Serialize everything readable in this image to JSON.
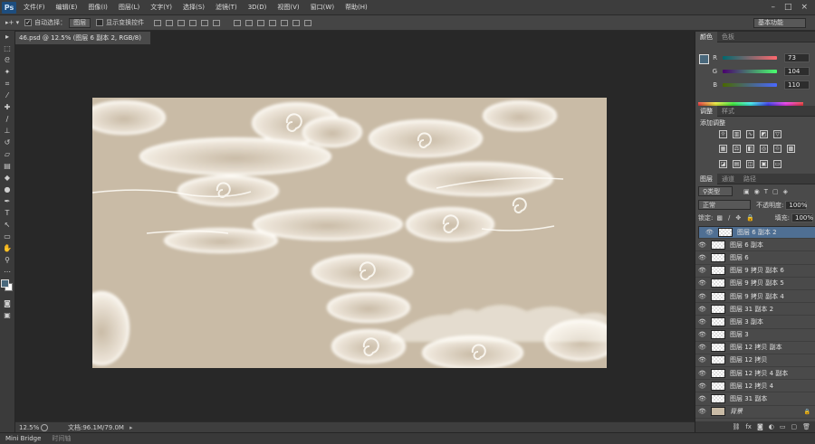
{
  "menubar": {
    "logo": "Ps",
    "items": [
      "文件(F)",
      "编辑(E)",
      "图像(I)",
      "图层(L)",
      "文字(Y)",
      "选择(S)",
      "滤镜(T)",
      "3D(D)",
      "视图(V)",
      "窗口(W)",
      "帮助(H)"
    ],
    "window_controls": [
      "minimize-icon",
      "maximize-icon",
      "close-icon"
    ]
  },
  "options": {
    "auto_select_label": "自动选择：",
    "auto_select_checked": true,
    "auto_select_value": "图层",
    "show_transform_label": "显示变换控件",
    "workspace": "基本功能"
  },
  "document": {
    "tab_title": "46.psd @ 12.5% (图层 6 副本 2, RGB/8)",
    "zoom": "12.5%",
    "doc_info": "文档:96.1M/79.0M",
    "canvas_color": "#c9bba6"
  },
  "bottom_tabs": [
    "Mini Bridge",
    "时间轴"
  ],
  "color_panel": {
    "tabs": [
      "颜色",
      "色板"
    ],
    "fg_color": "#49687c",
    "channels": [
      {
        "label": "R",
        "value": "73"
      },
      {
        "label": "G",
        "value": "104"
      },
      {
        "label": "B",
        "value": "110"
      }
    ]
  },
  "adjust_panel": {
    "tabs": [
      "调整",
      "样式"
    ],
    "title": "添加调整"
  },
  "layers_panel": {
    "tabs": [
      "图层",
      "通道",
      "路径"
    ],
    "filter": "类型",
    "blend_mode": "正常",
    "opacity_label": "不透明度:",
    "opacity": "100%",
    "lock_label": "锁定:",
    "fill_label": "填充:",
    "fill": "100%",
    "layers": [
      {
        "name": "图层 6 副本 2",
        "selected": true
      },
      {
        "name": "图层 6 副本"
      },
      {
        "name": "图层 6"
      },
      {
        "name": "图层 9 拷贝 副本 6"
      },
      {
        "name": "图层 9 拷贝 副本 5"
      },
      {
        "name": "图层 9 拷贝 副本 4"
      },
      {
        "name": "图层 31 副本 2"
      },
      {
        "name": "图层 3 副本"
      },
      {
        "name": "图层 3"
      },
      {
        "name": "图层 12 拷贝 副本"
      },
      {
        "name": "图层 12 拷贝"
      },
      {
        "name": "图层 12 拷贝 4 副本"
      },
      {
        "name": "图层 12 拷贝 4"
      },
      {
        "name": "图层 31 副本"
      },
      {
        "name": "背景",
        "background": true
      }
    ]
  }
}
